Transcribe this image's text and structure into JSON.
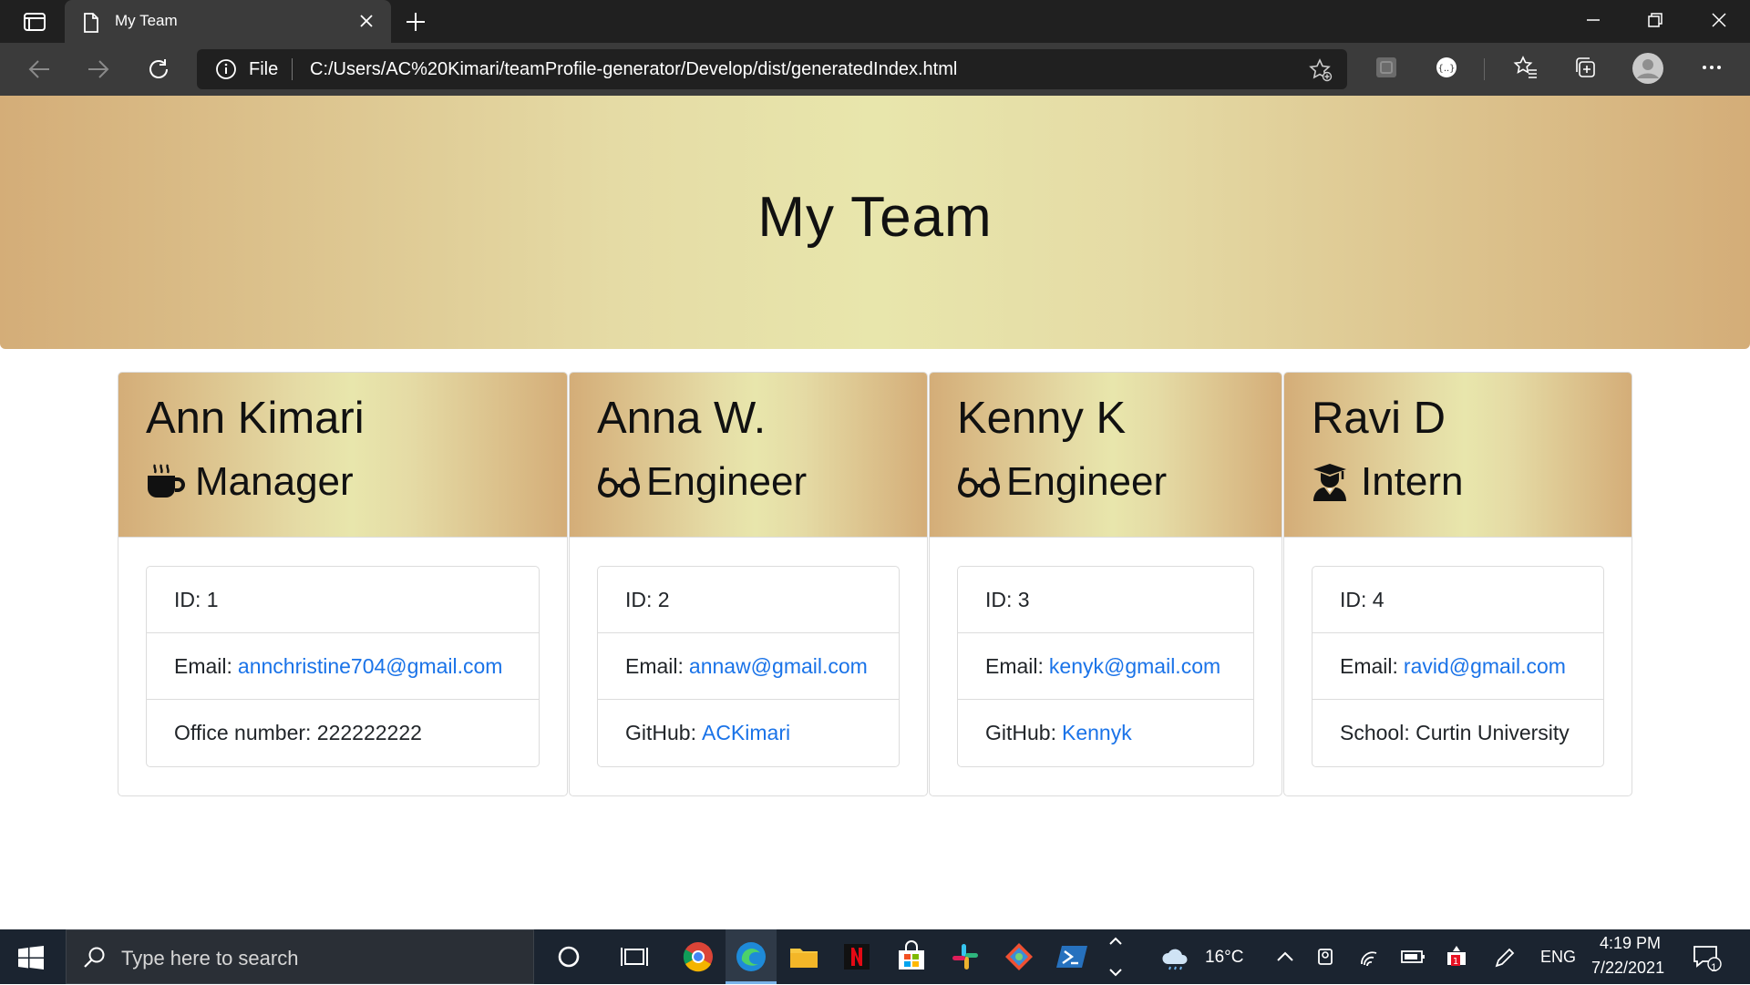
{
  "browser": {
    "tab_title": "My Team",
    "address_prefix": "File",
    "url": "C:/Users/AC%20Kimari/teamProfile-generator/Develop/dist/generatedIndex.html"
  },
  "page": {
    "heading": "My Team",
    "cards": [
      {
        "name": "Ann Kimari",
        "role": "Manager",
        "role_icon": "mug-icon",
        "id_text": "ID: 1",
        "email_label": "Email:",
        "email": "annchristine704@gmail.com",
        "extra_label": "Office number: 222222222",
        "extra_link": ""
      },
      {
        "name": "Anna W.",
        "role": "Engineer",
        "role_icon": "glasses-icon",
        "id_text": "ID: 2",
        "email_label": "Email:",
        "email": "annaw@gmail.com",
        "extra_label": "GitHub:",
        "extra_link": "ACKimari"
      },
      {
        "name": "Kenny K",
        "role": "Engineer",
        "role_icon": "glasses-icon",
        "id_text": "ID: 3",
        "email_label": "Email:",
        "email": "kenyk@gmail.com",
        "extra_label": "GitHub:",
        "extra_link": "Kennyk"
      },
      {
        "name": "Ravi D",
        "role": "Intern",
        "role_icon": "graduate-icon",
        "id_text": "ID: 4",
        "email_label": "Email:",
        "email": "ravid@gmail.com",
        "extra_label": "School: Curtin University",
        "extra_link": ""
      }
    ]
  },
  "taskbar": {
    "search_placeholder": "Type here to search",
    "temperature": "16°C",
    "language": "ENG",
    "time": "4:19 PM",
    "date": "7/22/2021",
    "notification_count": "1"
  },
  "colors": {
    "link": "#1a73e8",
    "header_gradient_edge": "#d4ad78",
    "header_gradient_center": "#e8e6ac"
  }
}
